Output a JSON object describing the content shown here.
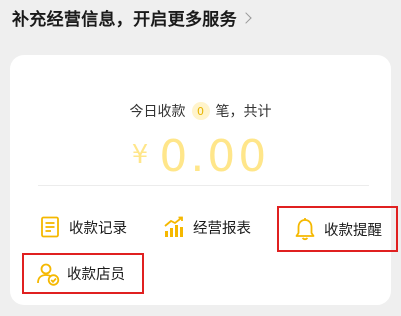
{
  "banner": {
    "text": "补充经营信息，开启更多服务",
    "chevron_icon": "chevron-right-icon"
  },
  "summary": {
    "prefix": "今日收款",
    "count": "0",
    "suffix": "笔，共计",
    "currency": "¥",
    "amount": "0.00"
  },
  "actions": [
    {
      "label": "收款记录",
      "icon": "document-icon",
      "highlighted": false
    },
    {
      "label": "经营报表",
      "icon": "bar-chart-icon",
      "highlighted": false
    },
    {
      "label": "收款提醒",
      "icon": "bell-icon",
      "highlighted": true
    },
    {
      "label": "收款店员",
      "icon": "staff-icon",
      "highlighted": true
    }
  ],
  "colors": {
    "accent": "#f5b800",
    "amount": "#ffe68a",
    "highlight_border": "#e02020"
  }
}
